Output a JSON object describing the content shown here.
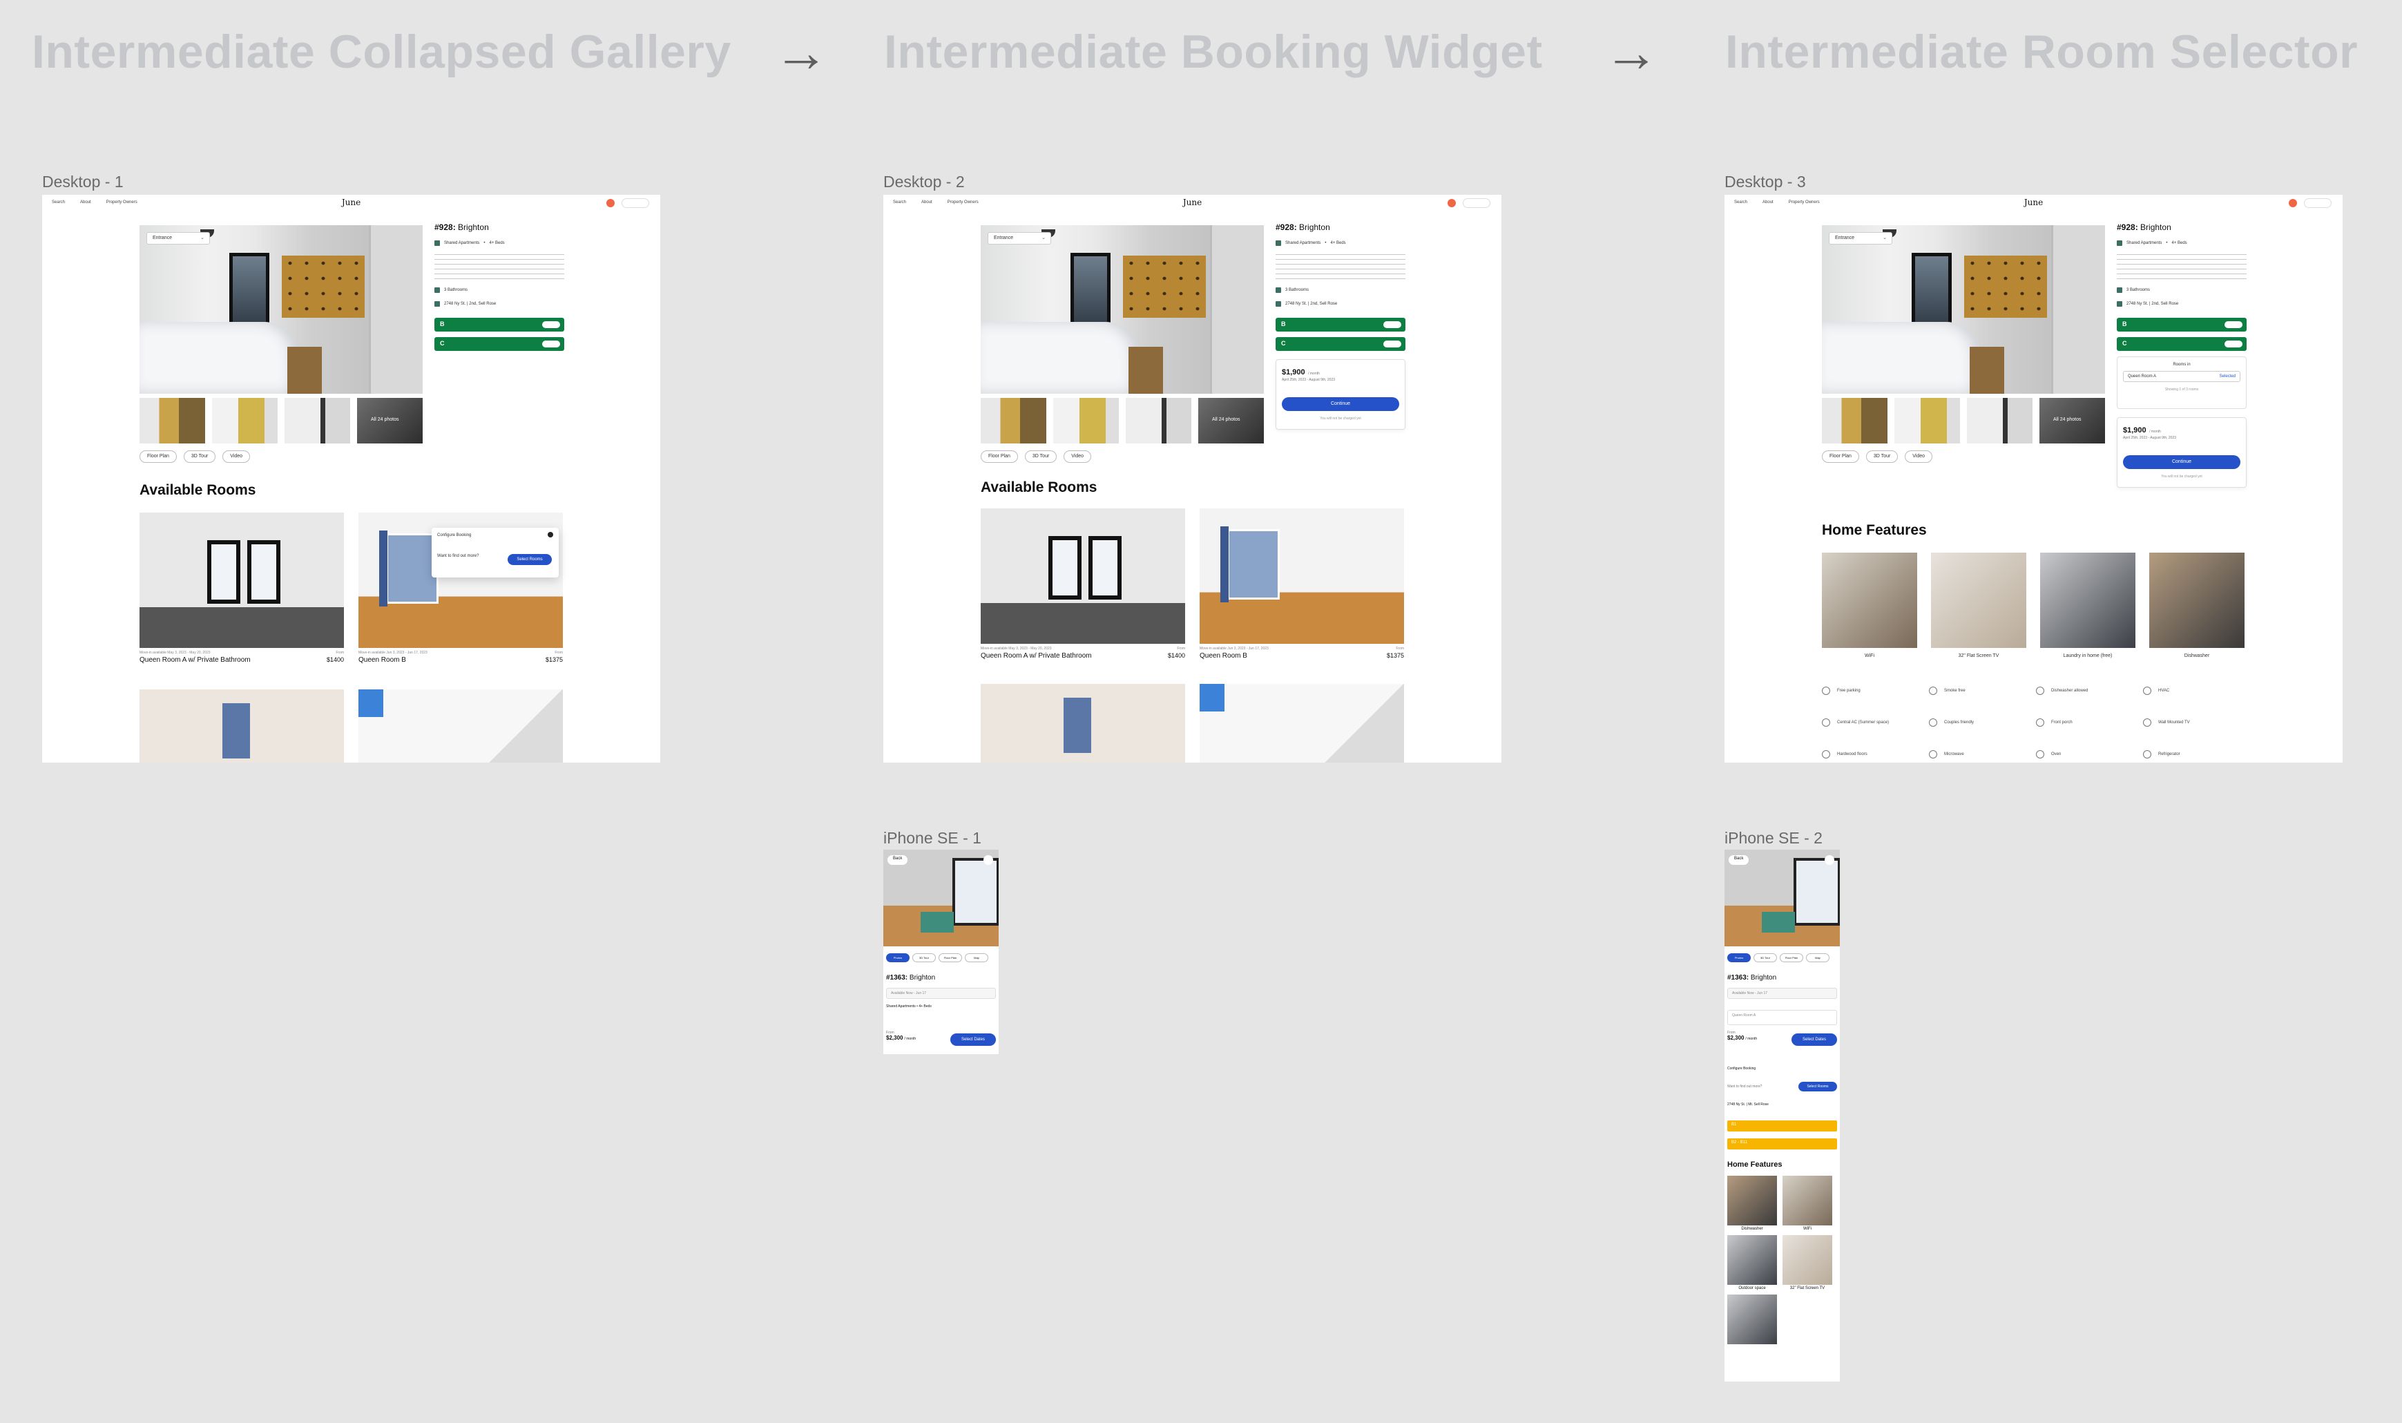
{
  "flow": {
    "step1": "Intermediate Collapsed Gallery",
    "step2": "Intermediate Booking Widget",
    "step3": "Intermediate Room Selector",
    "arrow": "→"
  },
  "frames": {
    "desktop1": "Desktop - 1",
    "desktop2": "Desktop - 2",
    "desktop3": "Desktop - 3",
    "iphone1": "iPhone SE - 1",
    "iphone2": "iPhone SE - 2"
  },
  "nav": {
    "links": [
      "Search",
      "About",
      "Property Owners"
    ],
    "logo": "June",
    "menu_label": "Hi!"
  },
  "listing": {
    "number": "#928:",
    "name": "Brighton",
    "type": "Shared Apartments",
    "beds": "4+ Beds",
    "bathrooms": "3 Bathrooms",
    "address": "2748 Ny St. | 2nd, Sell Rose",
    "room_b": "B",
    "room_c": "C",
    "read_more": "Read more",
    "gallery_select": "Entrance",
    "all_photos": "All 24 photos",
    "pills": [
      "Floor Plan",
      "3D Tour",
      "Video"
    ]
  },
  "booking": {
    "price": "$1,900",
    "per": "/ month",
    "dates": "April 25th, 2023 - August 9th, 2023",
    "continue": "Continue",
    "note": "You will not be charged yet",
    "rooms_title": "Rooms in",
    "room_option": "Queen Room A",
    "room_option_tag": "Selected",
    "showing": "Showing 1 of 3 rooms"
  },
  "sections": {
    "available_rooms": "Available Rooms",
    "home_features": "Home Features"
  },
  "rooms": [
    {
      "meta": "Move-in available May 3, 2023 - May 20, 2023",
      "name": "Queen Room A w/ Private Bathroom",
      "price_label": "From",
      "price": "$1400"
    },
    {
      "meta": "Move-in available Jun 3, 2023 - Jun 17, 2023",
      "name": "Queen Room B",
      "price_label": "From",
      "price": "$1375"
    }
  ],
  "popover": {
    "title": "Configure Booking",
    "question": "Want to find out more?",
    "button": "Select Rooms"
  },
  "features": [
    "WiFi",
    "32\" Flat Screen TV",
    "Laundry in home (free)",
    "Dishwasher"
  ],
  "amenities": [
    "Free parking",
    "Smoke free",
    "Dishwasher allowed",
    "HVAC",
    "Central AC (Summer space)",
    "Couples friendly",
    "Front porch",
    "Wall Mounted TV",
    "Hardwood floors",
    "Microwave",
    "Oven",
    "Refrigerator"
  ],
  "phone": {
    "back": "Back",
    "pills": [
      "Photos",
      "3D Tour",
      "Floor Plan",
      "Map"
    ],
    "number": "#1363:",
    "name": "Brighton",
    "available": "Available Now - Jun 17",
    "type_line": "Shared Apartments  •  4+ Beds",
    "from": "From",
    "price": "$2,300",
    "per": "/ month",
    "select_dates": "Select Dates",
    "room_select": "Queen Room A",
    "configure": "Configure Booking",
    "want_more": "Want to find out more?",
    "select_rooms": "Select Rooms",
    "address": "2748 Ny St. | Mt. Sell Rose",
    "bar1": "B1",
    "bar2": "B2 - B11",
    "features_title": "Home Features",
    "features": [
      "Dishwasher",
      "WiFi",
      "Outdoor space",
      "32\" Flat Screen TV"
    ]
  }
}
